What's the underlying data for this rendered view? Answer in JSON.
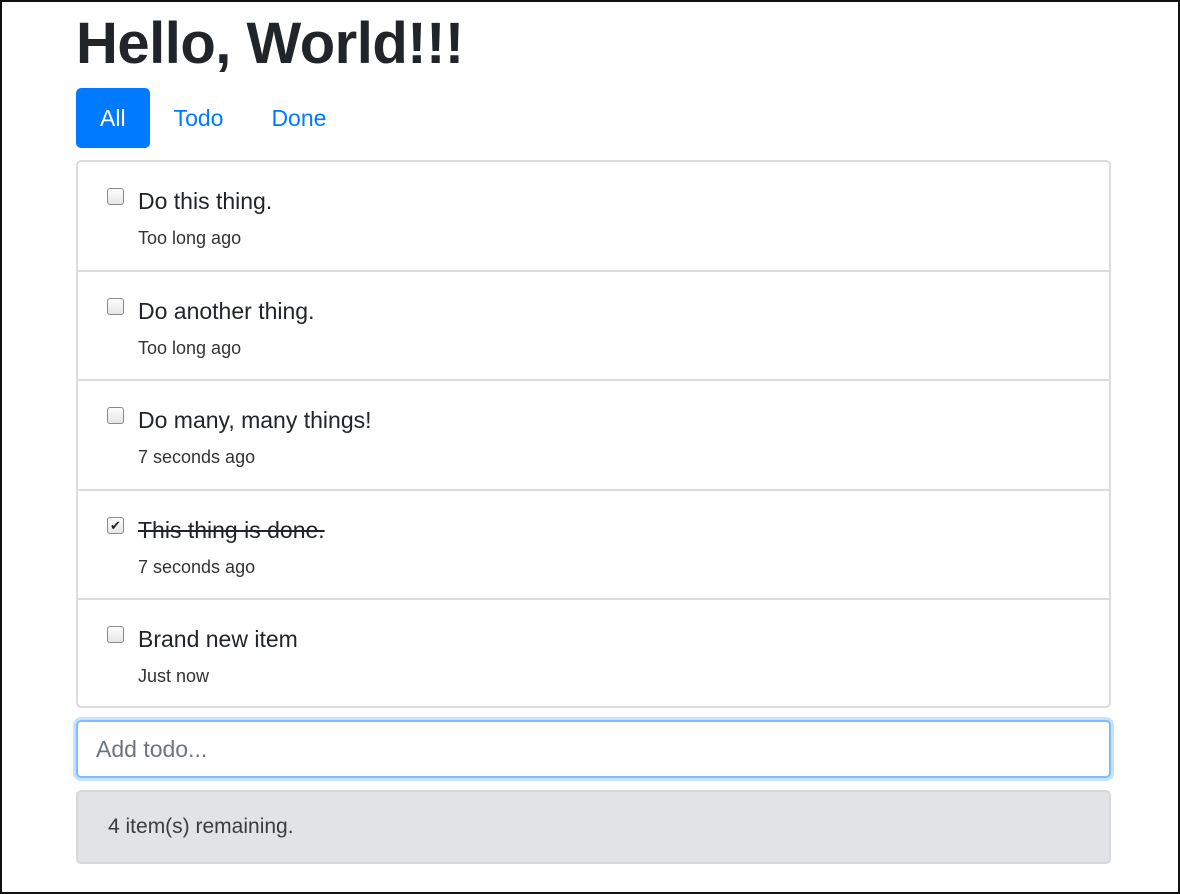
{
  "app": {
    "title": "Hello, World!!!"
  },
  "tabs": [
    {
      "label": "All",
      "active": true
    },
    {
      "label": "Todo",
      "active": false
    },
    {
      "label": "Done",
      "active": false
    }
  ],
  "todos": [
    {
      "text": "Do this thing.",
      "time": "Too long ago",
      "done": false
    },
    {
      "text": "Do another thing.",
      "time": "Too long ago",
      "done": false
    },
    {
      "text": "Do many, many things!",
      "time": "7 seconds ago",
      "done": false
    },
    {
      "text": "This thing is done.",
      "time": "7 seconds ago",
      "done": true
    },
    {
      "text": "Brand new item",
      "time": "Just now",
      "done": false
    }
  ],
  "input": {
    "placeholder": "Add todo...",
    "value": ""
  },
  "status": {
    "remaining_text": "4 item(s) remaining."
  },
  "colors": {
    "accent": "#007bff",
    "focus_ring": "#80bdff",
    "footer_bg": "#e2e3e5"
  }
}
